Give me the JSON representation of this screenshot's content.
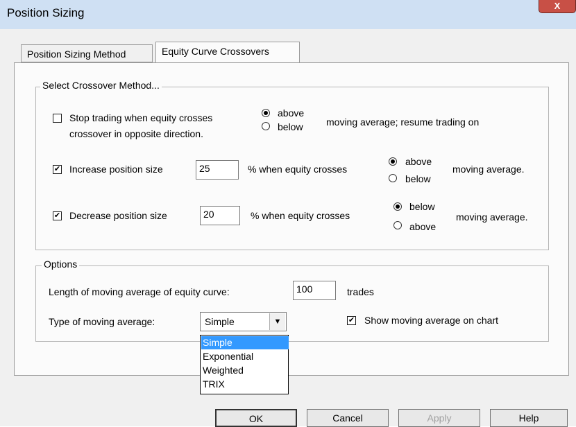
{
  "window": {
    "title": "Position Sizing",
    "close_label": "X"
  },
  "tabs": [
    {
      "label": "Position Sizing Method",
      "active": false
    },
    {
      "label": "Equity Curve Crossovers",
      "active": true
    }
  ],
  "crossover_group": {
    "title": "Select Crossover Method...",
    "stop_trading": {
      "checked": false,
      "label_line1": "Stop trading when equity crosses",
      "label_line2": "crossover in opposite direction.",
      "radio_above": {
        "label": "above",
        "selected": true
      },
      "radio_below": {
        "label": "below",
        "selected": false
      },
      "suffix": "moving average; resume trading on"
    },
    "increase": {
      "checked": true,
      "label": "Increase position size",
      "value": "25",
      "middle": "% when equity crosses",
      "radio_above": {
        "label": "above",
        "selected": true
      },
      "radio_below": {
        "label": "below",
        "selected": false
      },
      "suffix": "moving average."
    },
    "decrease": {
      "checked": true,
      "label": "Decrease position size",
      "value": "20",
      "middle": "% when equity crosses",
      "radio_below": {
        "label": "below",
        "selected": true
      },
      "radio_above": {
        "label": "above",
        "selected": false
      },
      "suffix": "moving average."
    }
  },
  "options_group": {
    "title": "Options",
    "length_label": "Length of moving average of equity curve:",
    "length_value": "100",
    "length_unit": "trades",
    "type_label": "Type of moving average:",
    "type_selected": "Simple",
    "type_options": [
      "Simple",
      "Exponential",
      "Weighted",
      "TRIX"
    ],
    "show_on_chart": {
      "checked": true,
      "label": "Show moving average on chart"
    }
  },
  "buttons": {
    "ok": "OK",
    "cancel": "Cancel",
    "apply": "Apply",
    "help": "Help"
  },
  "icons": {
    "check": "✔",
    "dropdown_arrow": "▼"
  }
}
